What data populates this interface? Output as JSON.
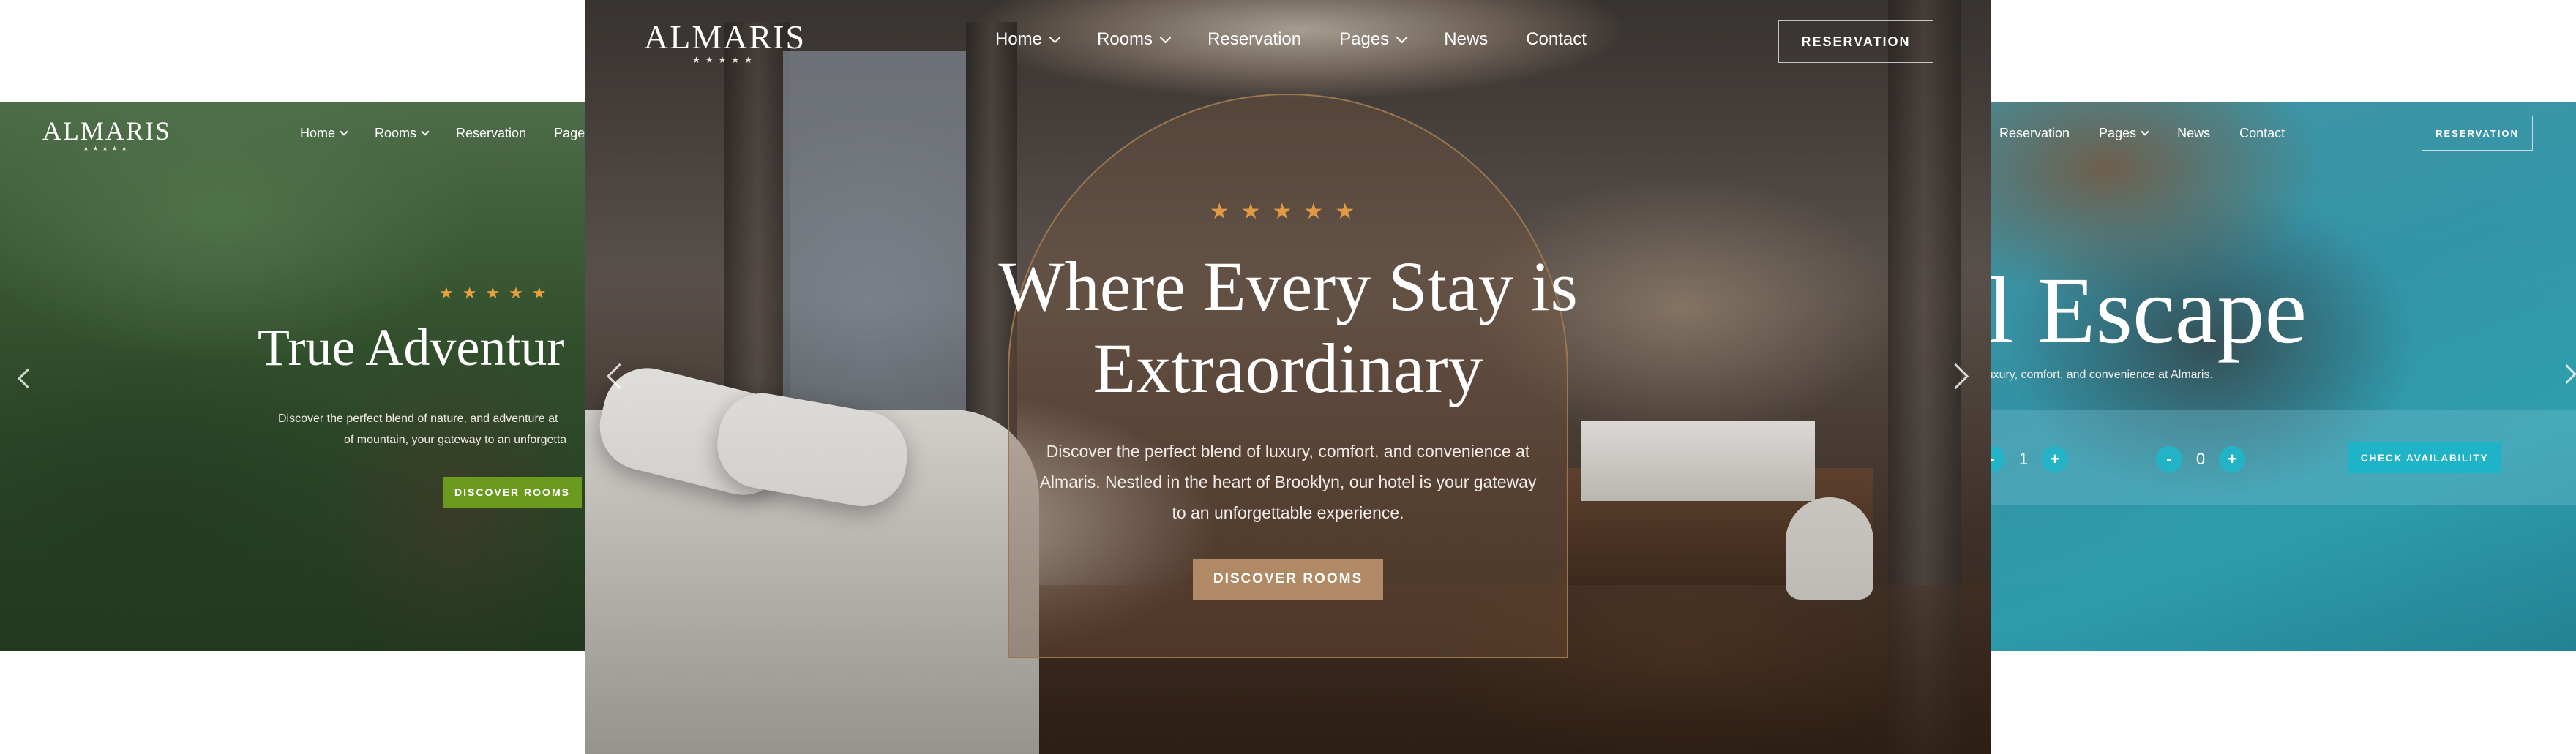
{
  "brand": {
    "logo": "ALMARIS",
    "logo_stars": "★★★★★"
  },
  "nav": {
    "home": "Home",
    "rooms": "Rooms",
    "reservation": "Reservation",
    "pages": "Pages",
    "news": "News",
    "contact": "Contact",
    "reservation_button": "RESERVATION"
  },
  "slides": {
    "left": {
      "stars": "★★★★★",
      "title": "True Adventur",
      "description_line1": "Discover the perfect blend of nature, and adventure at",
      "description_line2": "of mountain, your gateway to an unforgetta",
      "button": "DISCOVER ROOMS",
      "accent_color": "#6a9a1e"
    },
    "center": {
      "stars": "★★★★★",
      "title_line1": "Where Every Stay is",
      "title_line2": "Extraordinary",
      "description_line1": "Discover the perfect blend of luxury, comfort, and convenience at",
      "description_line2": "Almaris. Nestled in the heart of Brooklyn, our hotel is your gateway",
      "description_line3": "to an unforgettable experience.",
      "button": "DISCOVER ROOMS",
      "accent_color": "#b08a64"
    },
    "right": {
      "title": "cal Escape",
      "description": "d of luxury, comfort, and convenience at Almaris.",
      "guests": [
        {
          "minus": "-",
          "value": "1",
          "plus": "+"
        },
        {
          "minus": "-",
          "value": "0",
          "plus": "+"
        }
      ],
      "check_button": "CHECK AVAILABILITY",
      "accent_color": "#1fb3c7"
    }
  }
}
